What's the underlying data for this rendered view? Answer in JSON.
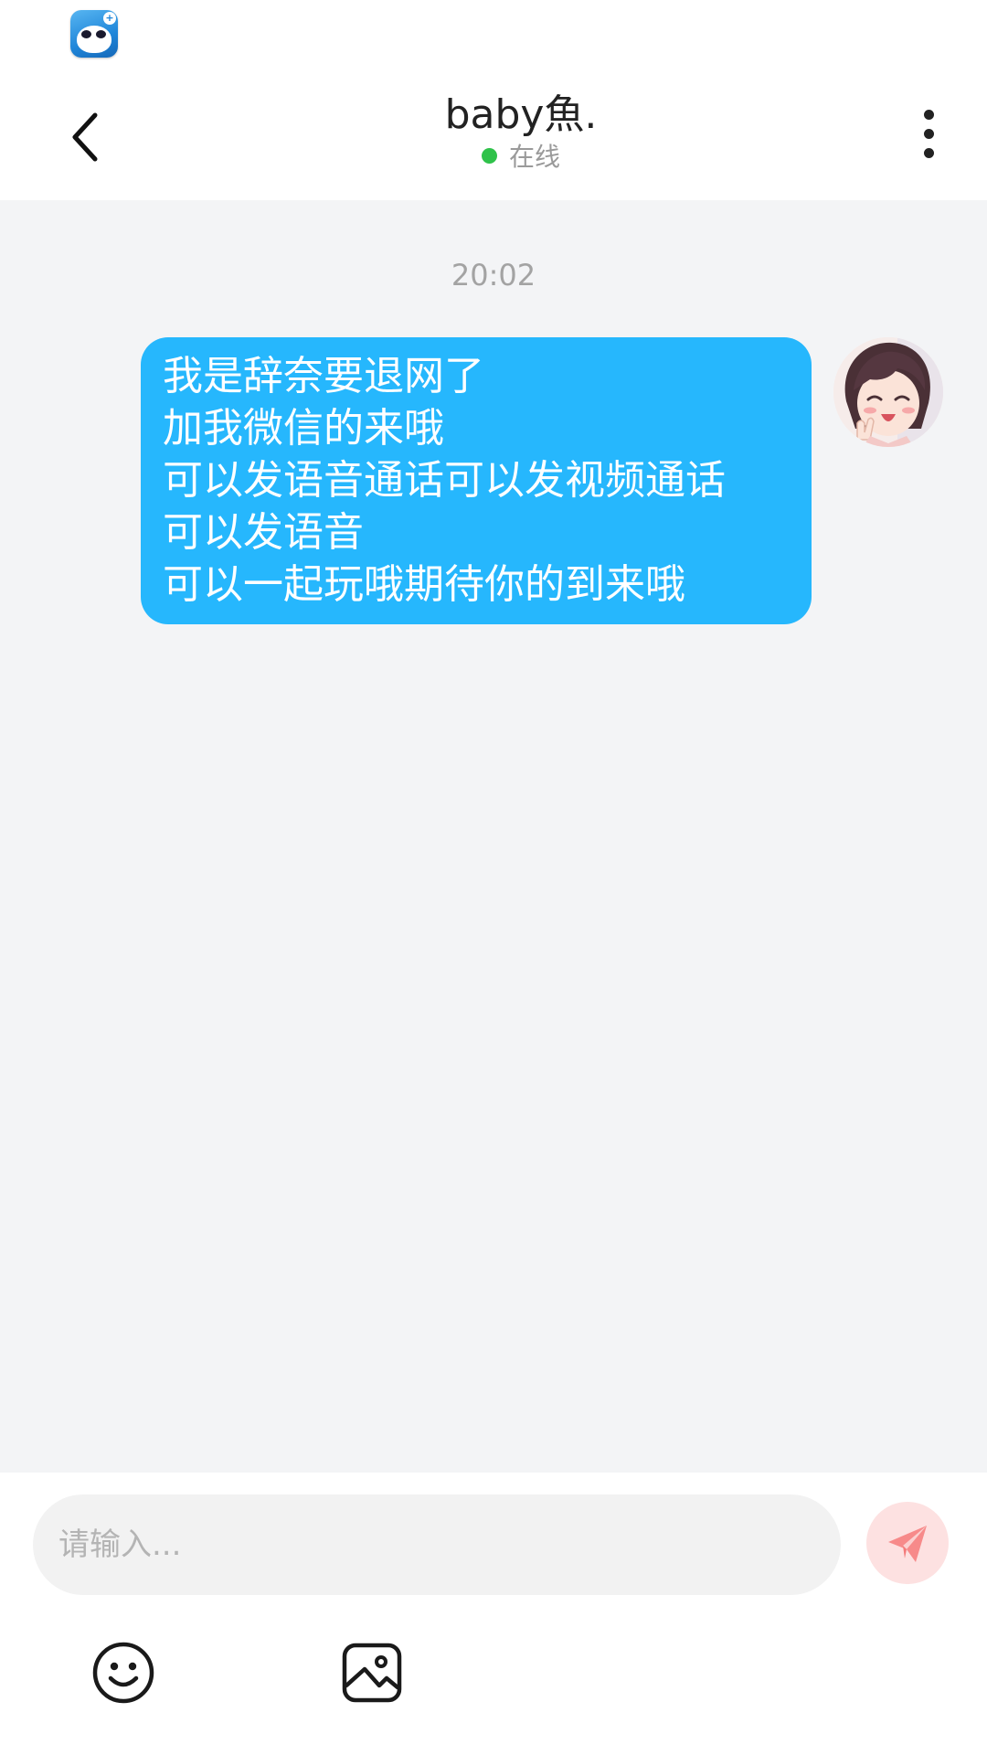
{
  "status_bar": {
    "app_icon": "bilibili-style-app-icon"
  },
  "header": {
    "title": "baby魚.",
    "presence": "在线",
    "presence_color": "#2fc24a",
    "back_icon": "chevron-left-icon",
    "more_icon": "more-vertical-icon"
  },
  "chat": {
    "timestamp": "20:02",
    "messages": [
      {
        "sender": "self",
        "bubble_color": "#26b7fd",
        "lines": [
          "我是辞奈要退网了",
          "加我微信的来哦",
          "可以发语音通话可以发视频通话",
          "可以发语音",
          "可以一起玩哦期待你的到来哦"
        ]
      }
    ]
  },
  "composer": {
    "placeholder": "请输入...",
    "send_icon": "paper-plane-icon",
    "send_color": "#f86d6d",
    "emoji_icon": "smiley-icon",
    "image_icon": "image-icon"
  }
}
